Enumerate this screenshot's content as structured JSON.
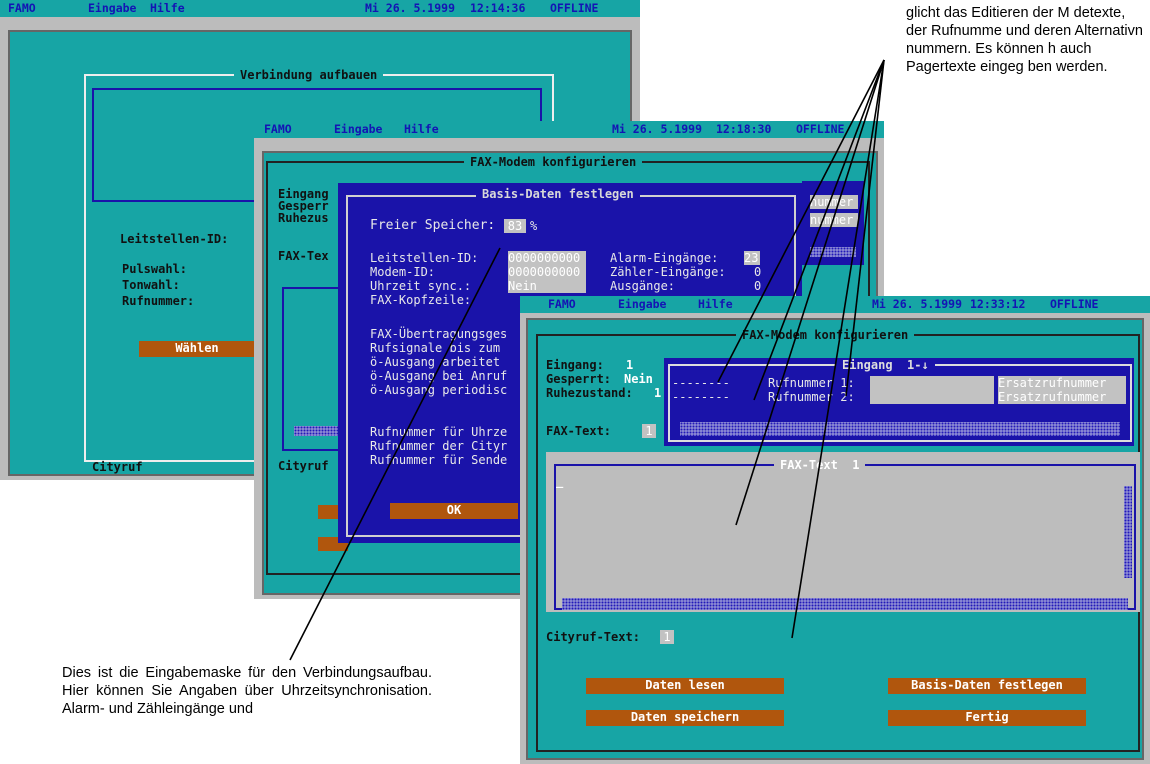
{
  "menu": {
    "app": "FAMO",
    "input": "Eingabe",
    "help": "Hilfe",
    "offline": "OFFLINE",
    "date": "Mi 26. 5.1999"
  },
  "screen1": {
    "time": "12:14:36",
    "title": "Verbindung aufbauen",
    "leitstellen": "Leitstellen-ID:",
    "pulswahl": "Pulswahl:",
    "tonwahl": "Tonwahl:",
    "rufnummer": "Rufnummer:",
    "waehlen": "Wählen",
    "cityruf": "Cityruf"
  },
  "screen2": {
    "time": "12:18:30",
    "title": "FAX-Modem konfigurieren",
    "left_labels": [
      "Eingang",
      "Gesperr",
      "Ruhezus",
      "FAX-Tex"
    ],
    "right_labels": [
      "nummer",
      "nummer"
    ],
    "cityruf": "Cityruf",
    "dialog_title": "Basis-Daten festlegen",
    "freier": "Freier Speicher:",
    "freier_val": "83",
    "percent": "%",
    "leitstellen": "Leitstellen-ID:",
    "leitstellen_val": "0000000000",
    "modem": "Modem-ID:",
    "modem_val": "0000000000",
    "uhrzeit": "Uhrzeit sync.:",
    "uhrzeit_val": "Nein",
    "faxkopf": "FAX-Kopfzeile:",
    "alarm": "Alarm-Eingänge:",
    "alarm_val": "23",
    "zaehler": "Zähler-Eingänge:",
    "zaehler_val": "0",
    "ausgaenge": "Ausgänge:",
    "ausgaenge_val": "0",
    "lines": [
      "FAX-Übertragungsges",
      "Rufsignale bis zum",
      "ö-Ausgang arbeitet",
      "ö-Ausgang bei Anruf",
      "ö-Ausgang periodisc"
    ],
    "lines2": [
      "Rufnummer für Uhrze",
      "Rufnummer der Cityr",
      "Rufnummer für Sende"
    ],
    "ok": "OK"
  },
  "screen3": {
    "time": "12:33:12",
    "title": "FAX-Modem konfigurieren",
    "eingang": "Eingang:",
    "eingang_val": "1",
    "gesperrt": "Gesperrt:",
    "gesperrt_val": "Nein",
    "ruhe": "Ruhezustand:",
    "ruhe_val": "1",
    "faxtext": "FAX-Text:",
    "faxtext_val": "1",
    "panel_title": "Eingang  1-↓",
    "dashes": "--------",
    "rufnummer1": "Rufnummer 1:",
    "rufnummer2": "Rufnummer 2:",
    "ersatz": "Ersatzrufnummer",
    "faxtext_title": "FAX-Text  1",
    "cursor": "_",
    "cityruf": "Cityruf-Text:",
    "cityruf_val": "1",
    "btn_lesen": "Daten lesen",
    "btn_basis": "Basis-Daten festlegen",
    "btn_speichern": "Daten speichern",
    "btn_fertig": "Fertig"
  },
  "notes": {
    "top": "glicht das Editieren der M detexte, der Rufnumme und deren Alternativn nummern. Es können h auch Pagertexte eingeg ben werden.",
    "bottom": "Dies ist die Eingabemaske für den Verbindungsaufbau. Hier können Sie Angaben über Uhrzeitsynchronisation. Alarm- und Zähleingänge und"
  }
}
